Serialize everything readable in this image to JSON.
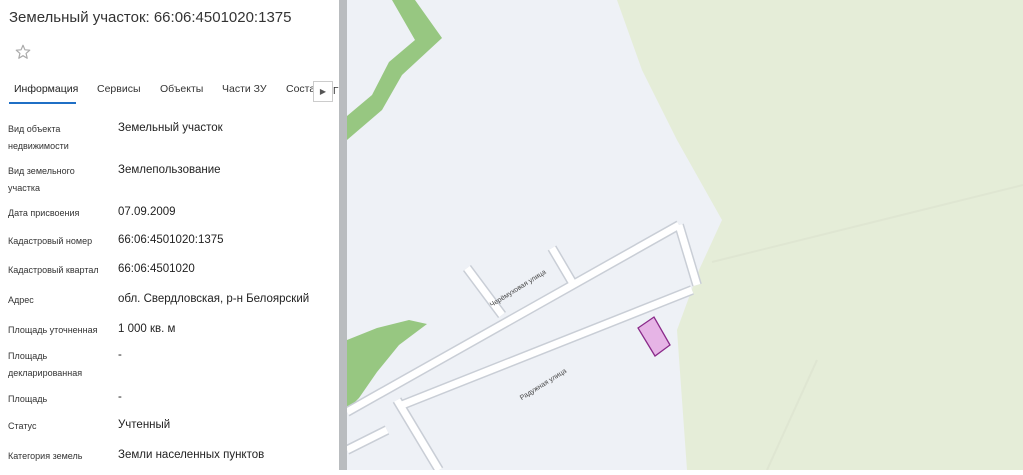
{
  "panel": {
    "title": "Земельный участок: 66:06:4501020:1375",
    "favorite_icon": "star-icon",
    "tabs": [
      {
        "label": "Информация",
        "active": true
      },
      {
        "label": "Сервисы"
      },
      {
        "label": "Объекты"
      },
      {
        "label": "Части ЗУ"
      },
      {
        "label": "Соста"
      }
    ],
    "tabs_scroll_icon": "caret-right-icon",
    "tabs_overflow_text": "Г",
    "rows": [
      {
        "label": "Вид объекта недвижимости",
        "value": "Земельный участок"
      },
      {
        "label": "Вид земельного участка",
        "value": "Землепользование"
      },
      {
        "label": "Дата присвоения",
        "value": "07.09.2009"
      },
      {
        "label": "Кадастровый номер",
        "value": "66:06:4501020:1375"
      },
      {
        "label": "Кадастровый квартал",
        "value": "66:06:4501020"
      },
      {
        "label": "Адрес",
        "value": "обл. Свердловская, р-н Белоярский"
      },
      {
        "label": "Площадь уточненная",
        "value": "1 000 кв. м"
      },
      {
        "label": "Площадь декларированная",
        "value": "-"
      },
      {
        "label": "Площадь",
        "value": "-"
      },
      {
        "label": "Статус",
        "value": "Учтенный"
      },
      {
        "label": "Категория земель",
        "value": "Земли населенных пунктов"
      }
    ]
  },
  "map": {
    "streets": [
      "Черёмуховая улица",
      "Радужная улица"
    ],
    "colors": {
      "background": "#eef1f6",
      "forest_light": "#e5edd8",
      "forest_green": "#97c781",
      "road_fill": "#ffffff",
      "road_edge": "#c9ced6",
      "parcel_fill": "#e6b4e6",
      "parcel_stroke": "#8a2a8a",
      "divider": "#b9bcbf",
      "tab_accent": "#1f6fc5"
    }
  }
}
